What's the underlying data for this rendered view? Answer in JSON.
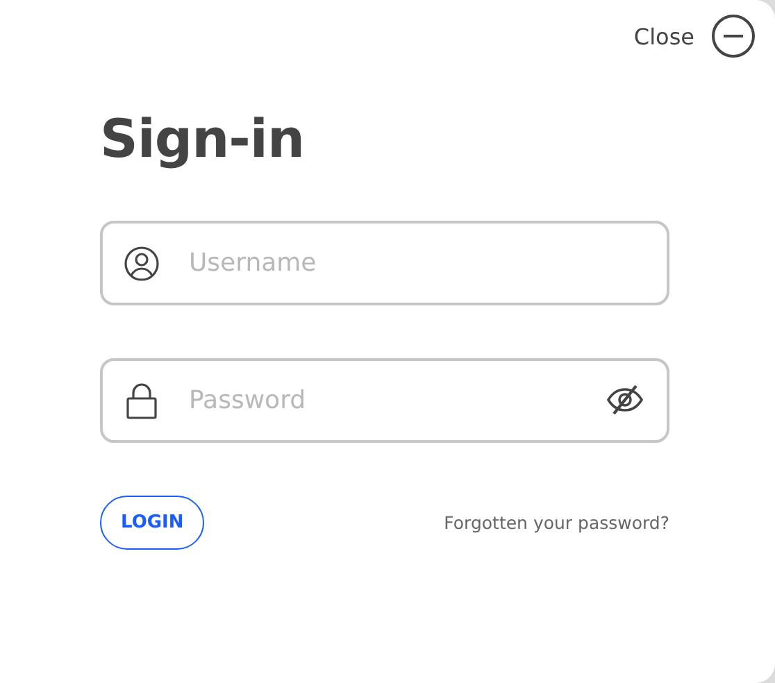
{
  "close": {
    "label": "Close"
  },
  "title": "Sign-in",
  "fields": [
    {
      "kind": "user",
      "placeholder": "Username"
    },
    {
      "kind": "password",
      "placeholder": "Password"
    }
  ],
  "login_button": "LOGIN",
  "forgot_link": "Forgotten your password?"
}
